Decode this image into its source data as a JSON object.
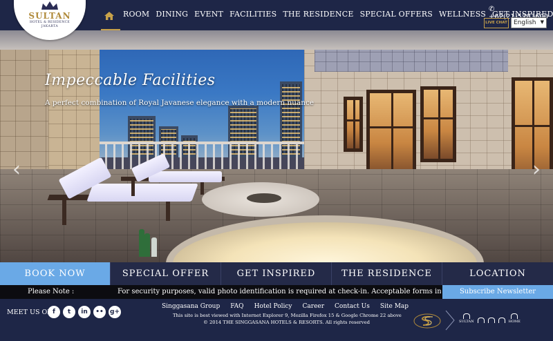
{
  "header": {
    "logo": {
      "brand": "SULTAN",
      "subtitle": "HOTEL & RESIDENCE",
      "city": "JAKARTA",
      "colors": {
        "gold": "#b08a3a",
        "navy": "#2b2d55"
      }
    },
    "home_icon": "home-icon",
    "menu": [
      "ROOM",
      "DINING",
      "EVENT",
      "FACILITIES",
      "THE RESIDENCE",
      "SPECIAL OFFERS",
      "WELLNESS",
      "GET INSPIRED"
    ],
    "phone": "+62(21)5703600",
    "live_chat": "LIVE CHAT",
    "language": "English"
  },
  "hero": {
    "title": "Impeccable Facilities",
    "subtitle": "A perfect combination of Royal Javanese elegance with a modern nuance",
    "prev_icon": "chevron-left-icon",
    "next_icon": "chevron-right-icon"
  },
  "tabs": [
    {
      "label": "BOOK NOW",
      "active": true
    },
    {
      "label": "SPECIAL OFFER",
      "active": false
    },
    {
      "label": "GET INSPIRED",
      "active": false
    },
    {
      "label": "THE RESIDENCE",
      "active": false
    },
    {
      "label": "LOCATION",
      "active": false
    }
  ],
  "notice": {
    "label": "Please Note :",
    "text": "For security purposes, valid photo identification is required at check-in. Acceptable forms include a"
  },
  "subscribe": "Subscribe Newsletter",
  "footer": {
    "meet_us": "MEET US ON",
    "social": [
      {
        "icon": "facebook-icon",
        "glyph": "f"
      },
      {
        "icon": "twitter-icon",
        "glyph": "t"
      },
      {
        "icon": "linkedin-icon",
        "glyph": "in"
      },
      {
        "icon": "flickr-icon",
        "glyph": "••"
      },
      {
        "icon": "googleplus-icon",
        "glyph": "g+"
      }
    ],
    "links": [
      "Singgasana Group",
      "FAQ",
      "Hotel Policy",
      "Career",
      "Contact Us",
      "Site Map"
    ],
    "browser_note": "This site is best viewed with Internet Explorer 9, Mozilla Firefox 15 & Google Chrome 22 above",
    "copyright": "© 2014 THE SINGGASANA HOTELS & RESORTS. All rights reserved",
    "brands": [
      "SULTAN",
      "",
      "",
      "",
      "HOME"
    ]
  },
  "colors": {
    "nav_bg": "#1e2647",
    "accent_blue": "#6aa9e6",
    "gold": "#c8a24a",
    "tab_bg": "#242a48"
  }
}
